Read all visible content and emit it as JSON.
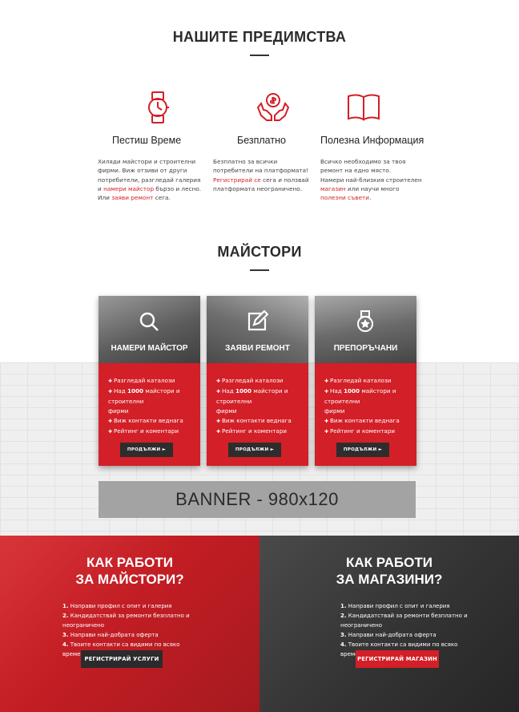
{
  "advantages": {
    "title": "НАШИТЕ ПРЕДИМСТВА",
    "items": [
      {
        "icon": "watch-icon",
        "title": "Пестиш Време",
        "lines": [
          [
            {
              "t": "Хиляди майстори и строителни"
            }
          ],
          [
            {
              "t": "фирми. Виж отзиви от други"
            }
          ],
          [
            {
              "t": "потребители, разгледай галерия"
            }
          ],
          [
            {
              "t": "и "
            },
            {
              "t": "намери майстор",
              "red": true
            },
            {
              "t": " бързо и лесно."
            }
          ],
          [
            {
              "t": "Или "
            },
            {
              "t": "заяви ремонт",
              "red": true
            },
            {
              "t": " сега."
            }
          ]
        ]
      },
      {
        "icon": "hands-coin-icon",
        "title": "Безплатно",
        "lines": [
          [
            {
              "t": "Безплатно за всички"
            }
          ],
          [
            {
              "t": "потребители на платформата!"
            }
          ],
          [
            {
              "t": "Регистрирай се",
              "red": true
            },
            {
              "t": " сега и ползвай"
            }
          ],
          [
            {
              "t": "платформата неограничено."
            }
          ]
        ]
      },
      {
        "icon": "open-book-icon",
        "title": "Полезна Информация",
        "lines": [
          [
            {
              "t": "Всичко необходимо за твоя"
            }
          ],
          [
            {
              "t": "ремонт на едно място."
            }
          ],
          [
            {
              "t": "Намери най-близкия строителен"
            }
          ],
          [
            {
              "t": "магазин",
              "red": true
            },
            {
              "t": " или научи много"
            }
          ],
          [
            {
              "t": "полезни съвети",
              "red": true
            },
            {
              "t": "."
            }
          ]
        ]
      }
    ]
  },
  "masters": {
    "title": "МАЙСТОРИ",
    "cards": [
      {
        "label": "НАМЕРИ МАЙСТОР",
        "icon": "search-icon",
        "photo_color": "#6f6f6f",
        "bullets": [
          [
            {
              "t": "Разгледай каталози"
            }
          ],
          [
            {
              "t": "Над "
            },
            {
              "t": "1000",
              "b": true
            },
            {
              "t": " майстори и"
            }
          ],
          [
            {
              "t": "строителни",
              "cont": true
            }
          ],
          [
            {
              "t": "фирми",
              "cont": true
            }
          ],
          [
            {
              "t": "Виж контакти веднага"
            }
          ],
          [
            {
              "t": "Рейтинг и коментари"
            }
          ]
        ],
        "button": "ПРОДЪЛЖИ ►"
      },
      {
        "label": "ЗАЯВИ РЕМОНТ",
        "icon": "edit-icon",
        "photo_color": "#7a7a7a",
        "bullets": [
          [
            {
              "t": "Разгледай каталози"
            }
          ],
          [
            {
              "t": "Над "
            },
            {
              "t": "1000",
              "b": true
            },
            {
              "t": " майстори и"
            }
          ],
          [
            {
              "t": "строителни",
              "cont": true
            }
          ],
          [
            {
              "t": "фирми",
              "cont": true
            }
          ],
          [
            {
              "t": "Виж контакти веднага"
            }
          ],
          [
            {
              "t": "Рейтинг и коментари"
            }
          ]
        ],
        "button": "ПРОДЪЛЖИ ►"
      },
      {
        "label": "ПРЕПОРЪЧАНИ",
        "icon": "medal-icon",
        "photo_color": "#737373",
        "bullets": [
          [
            {
              "t": "Разгледай каталози"
            }
          ],
          [
            {
              "t": "Над "
            },
            {
              "t": "1000",
              "b": true
            },
            {
              "t": " майстори и"
            }
          ],
          [
            {
              "t": "строителни",
              "cont": true
            }
          ],
          [
            {
              "t": "фирми",
              "cont": true
            }
          ],
          [
            {
              "t": "Виж контакти веднага"
            }
          ],
          [
            {
              "t": "Рейтинг и коментари"
            }
          ]
        ],
        "button": "ПРОДЪЛЖИ ►"
      }
    ]
  },
  "banner": {
    "text": "BANNER - 980x120"
  },
  "how": [
    {
      "title_line1": "КАК РАБОТИ",
      "title_line2": "ЗА МАЙСТОРИ?",
      "steps": [
        [
          {
            "t": "1.",
            "b": true
          },
          {
            "t": " Направи профил с опит и галерия"
          }
        ],
        [
          {
            "t": "2.",
            "b": true
          },
          {
            "t": " Кандидатствай за ремонти безплатно и"
          }
        ],
        [
          {
            "t": "неограничено",
            "cont": true
          }
        ],
        [
          {
            "t": "3.",
            "b": true
          },
          {
            "t": " Направи най-добрата оферта"
          }
        ],
        [
          {
            "t": "4.",
            "b": true
          },
          {
            "t": " Твоите контакти са видими по всяко"
          }
        ],
        [
          {
            "t": "време",
            "cont": true
          }
        ]
      ],
      "button": "РЕГИСТРИРАЙ УСЛУГИ",
      "bg": "#c8232a",
      "button_bg": "#2b2b2b"
    },
    {
      "title_line1": "КАК РАБОТИ",
      "title_line2": "ЗА МАГАЗИНИ?",
      "steps": [
        [
          {
            "t": "1.",
            "b": true
          },
          {
            "t": " Направи профил с опит и галерия"
          }
        ],
        [
          {
            "t": "2.",
            "b": true
          },
          {
            "t": " Кандидатствай за ремонти безплатно и"
          }
        ],
        [
          {
            "t": "неограничено",
            "cont": true
          }
        ],
        [
          {
            "t": "3.",
            "b": true
          },
          {
            "t": " Направи най-добрата оферта"
          }
        ],
        [
          {
            "t": "4.",
            "b": true
          },
          {
            "t": " Твоите контакти са видими по всяко"
          }
        ],
        [
          {
            "t": "време",
            "cont": true
          }
        ]
      ],
      "button": "РЕГИСТРИРАЙ МАГАЗИН",
      "bg": "#3a3a3a",
      "button_bg": "#d31f27"
    }
  ],
  "colors": {
    "accent": "#d31f27",
    "dark": "#2d2d2d",
    "banner": "#a3a3a3"
  }
}
